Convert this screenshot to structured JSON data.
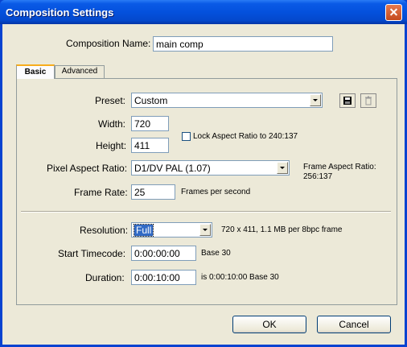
{
  "window": {
    "title": "Composition Settings"
  },
  "composition_name": {
    "label": "Composition Name:",
    "value": "main comp"
  },
  "tabs": [
    {
      "label": "Basic",
      "selected": true
    },
    {
      "label": "Advanced",
      "selected": false
    }
  ],
  "basic": {
    "preset": {
      "label": "Preset:",
      "value": "Custom"
    },
    "width": {
      "label": "Width:",
      "value": "720"
    },
    "height": {
      "label": "Height:",
      "value": "411"
    },
    "lock_aspect": {
      "label": "Lock Aspect Ratio to 240:137",
      "checked": false
    },
    "pixel_aspect": {
      "label": "Pixel Aspect Ratio:",
      "value": "D1/DV PAL (1.07)"
    },
    "frame_aspect": {
      "label": "Frame Aspect Ratio:",
      "value": "256:137"
    },
    "frame_rate": {
      "label": "Frame Rate:",
      "value": "25",
      "unit": "Frames per second"
    },
    "resolution": {
      "label": "Resolution:",
      "value": "Full",
      "info": "720 x 411, 1.1 MB per 8bpc frame"
    },
    "start_timecode": {
      "label": "Start Timecode:",
      "value": "0:00:00:00",
      "base": "Base 30"
    },
    "duration": {
      "label": "Duration:",
      "value": "0:00:10:00",
      "info": "is 0:00:10:00  Base 30"
    }
  },
  "buttons": {
    "ok": "OK",
    "cancel": "Cancel"
  },
  "icons": {
    "save": "save-preset-icon",
    "delete": "delete-preset-icon",
    "close": "close-icon"
  },
  "colors": {
    "titlebar": "#0451dd",
    "dialog_bg": "#ece9d8",
    "selection": "#316ac5"
  }
}
